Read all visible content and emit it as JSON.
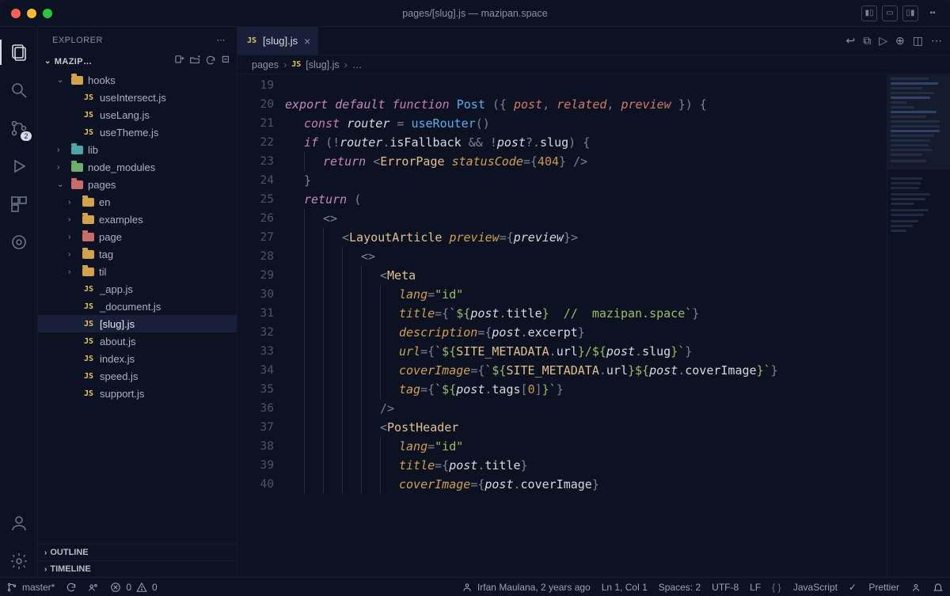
{
  "titlebar": {
    "title": "pages/[slug].js — mazipan.space"
  },
  "sidebar": {
    "header": "EXPLORER",
    "folder_title": "MAZIP…",
    "sections": {
      "outline": "OUTLINE",
      "timeline": "TIMELINE"
    }
  },
  "tree": [
    {
      "type": "folder",
      "label": "hooks",
      "depth": 1,
      "expanded": true,
      "color": "yellow"
    },
    {
      "type": "js",
      "label": "useIntersect.js",
      "depth": 2
    },
    {
      "type": "js",
      "label": "useLang.js",
      "depth": 2
    },
    {
      "type": "js",
      "label": "useTheme.js",
      "depth": 2
    },
    {
      "type": "folder",
      "label": "lib",
      "depth": 1,
      "expanded": false,
      "color": "teal"
    },
    {
      "type": "folder",
      "label": "node_modules",
      "depth": 1,
      "expanded": false,
      "color": "green"
    },
    {
      "type": "folder",
      "label": "pages",
      "depth": 1,
      "expanded": true,
      "color": "red"
    },
    {
      "type": "folder",
      "label": "en",
      "depth": 2,
      "expanded": false,
      "color": "yellow"
    },
    {
      "type": "folder",
      "label": "examples",
      "depth": 2,
      "expanded": false,
      "color": "yellow"
    },
    {
      "type": "folder",
      "label": "page",
      "depth": 2,
      "expanded": false,
      "color": "red"
    },
    {
      "type": "folder",
      "label": "tag",
      "depth": 2,
      "expanded": false,
      "color": "yellow"
    },
    {
      "type": "folder",
      "label": "til",
      "depth": 2,
      "expanded": false,
      "color": "yellow"
    },
    {
      "type": "js",
      "label": "_app.js",
      "depth": 2
    },
    {
      "type": "js",
      "label": "_document.js",
      "depth": 2
    },
    {
      "type": "js",
      "label": "[slug].js",
      "depth": 2,
      "selected": true
    },
    {
      "type": "js",
      "label": "about.js",
      "depth": 2
    },
    {
      "type": "js",
      "label": "index.js",
      "depth": 2
    },
    {
      "type": "js",
      "label": "speed.js",
      "depth": 2
    },
    {
      "type": "js",
      "label": "support.js",
      "depth": 2
    }
  ],
  "tab": {
    "label": "[slug].js"
  },
  "breadcrumb": {
    "parts": [
      "pages",
      "[slug].js",
      "…"
    ]
  },
  "source_control_badge": "2",
  "editor": {
    "first_line_number": 19,
    "lines": [
      {
        "n": 19,
        "indent": 0,
        "html": ""
      },
      {
        "n": 20,
        "indent": 0,
        "html": "<span class='kw'>export</span> <span class='kw'>default</span> <span class='kw2'>function</span> <span class='fn'>Post</span> <span class='pun'>({</span> <span class='param'>post</span><span class='pun'>,</span> <span class='param'>related</span><span class='pun'>,</span> <span class='param'>preview</span> <span class='pun'>}) {</span>"
      },
      {
        "n": 21,
        "indent": 1,
        "html": "<span class='kw2'>const</span> <span class='var'>router</span> <span class='pun'>=</span> <span class='fn'>useRouter</span><span class='pun'>()</span>"
      },
      {
        "n": 22,
        "indent": 1,
        "html": "<span class='kw'>if</span> <span class='pun'>(</span><span class='pun'>!</span><span class='var'>router</span><span class='pun'>.</span><span class='prop'>isFallback</span> <span class='pun'>&amp;&amp;</span> <span class='pun'>!</span><span class='var'>post</span><span class='pun'>?.</span><span class='prop'>slug</span><span class='pun'>) {</span>"
      },
      {
        "n": 23,
        "indent": 2,
        "html": "<span class='kw'>return</span> <span class='pun'>&lt;</span><span class='jsxc'>ErrorPage</span> <span class='attr'>statusCode</span><span class='pun'>={</span><span class='num'>404</span><span class='pun'>}</span> <span class='pun'>/&gt;</span>"
      },
      {
        "n": 24,
        "indent": 1,
        "html": "<span class='pun'>}</span>"
      },
      {
        "n": 25,
        "indent": 1,
        "html": "<span class='kw'>return</span> <span class='pun'>(</span>"
      },
      {
        "n": 26,
        "indent": 2,
        "html": "<span class='pun'>&lt;&gt;</span>"
      },
      {
        "n": 27,
        "indent": 3,
        "html": "<span class='pun'>&lt;</span><span class='jsxc'>LayoutArticle</span> <span class='attr'>preview</span><span class='pun'>={</span><span class='var'>preview</span><span class='pun'>}&gt;</span>"
      },
      {
        "n": 28,
        "indent": 4,
        "html": "<span class='pun'>&lt;&gt;</span>"
      },
      {
        "n": 29,
        "indent": 5,
        "html": "<span class='pun'>&lt;</span><span class='jsxc'>Meta</span>"
      },
      {
        "n": 30,
        "indent": 6,
        "html": "<span class='attr'>lang</span><span class='pun'>=</span><span class='str'>\"id\"</span>"
      },
      {
        "n": 31,
        "indent": 6,
        "html": "<span class='attr'>title</span><span class='pun'>={</span><span class='tmpl'>`${</span><span class='var'>post</span><span class='pun'>.</span><span class='prop'>title</span><span class='tmpl'>}  //  mazipan.space`</span><span class='pun'>}</span>"
      },
      {
        "n": 32,
        "indent": 6,
        "html": "<span class='attr'>description</span><span class='pun'>={</span><span class='var'>post</span><span class='pun'>.</span><span class='prop'>excerpt</span><span class='pun'>}</span>"
      },
      {
        "n": 33,
        "indent": 6,
        "html": "<span class='attr'>url</span><span class='pun'>={</span><span class='tmpl'>`${</span><span class='type'>SITE_METADATA</span><span class='pun'>.</span><span class='prop'>url</span><span class='tmpl'>}/${</span><span class='var'>post</span><span class='pun'>.</span><span class='prop'>slug</span><span class='tmpl'>}`</span><span class='pun'>}</span>"
      },
      {
        "n": 34,
        "indent": 6,
        "html": "<span class='attr'>coverImage</span><span class='pun'>={</span><span class='tmpl'>`${</span><span class='type'>SITE_METADATA</span><span class='pun'>.</span><span class='prop'>url</span><span class='tmpl'>}${</span><span class='var'>post</span><span class='pun'>.</span><span class='prop'>coverImage</span><span class='tmpl'>}`</span><span class='pun'>}</span>"
      },
      {
        "n": 35,
        "indent": 6,
        "html": "<span class='attr'>tag</span><span class='pun'>={</span><span class='tmpl'>`${</span><span class='var'>post</span><span class='pun'>.</span><span class='prop'>tags</span><span class='pun'>[</span><span class='num'>0</span><span class='pun'>]</span><span class='tmpl'>}`</span><span class='pun'>}</span>"
      },
      {
        "n": 36,
        "indent": 5,
        "html": "<span class='pun'>/&gt;</span>"
      },
      {
        "n": 37,
        "indent": 5,
        "html": "<span class='pun'>&lt;</span><span class='jsxc'>PostHeader</span>"
      },
      {
        "n": 38,
        "indent": 6,
        "html": "<span class='attr'>lang</span><span class='pun'>=</span><span class='str'>\"id\"</span>"
      },
      {
        "n": 39,
        "indent": 6,
        "html": "<span class='attr'>title</span><span class='pun'>={</span><span class='var'>post</span><span class='pun'>.</span><span class='prop'>title</span><span class='pun'>}</span>"
      },
      {
        "n": 40,
        "indent": 6,
        "html": "<span class='attr'>coverImage</span><span class='pun'>={</span><span class='var'>post</span><span class='pun'>.</span><span class='prop'>coverImage</span><span class='pun'>}</span>"
      }
    ]
  },
  "statusbar": {
    "branch": "master*",
    "errors": "0",
    "warnings": "0",
    "blame": "Irfan Maulana, 2 years ago",
    "cursor": "Ln 1, Col 1",
    "spaces": "Spaces: 2",
    "encoding": "UTF-8",
    "eol": "LF",
    "language": "JavaScript",
    "formatter": "Prettier"
  }
}
